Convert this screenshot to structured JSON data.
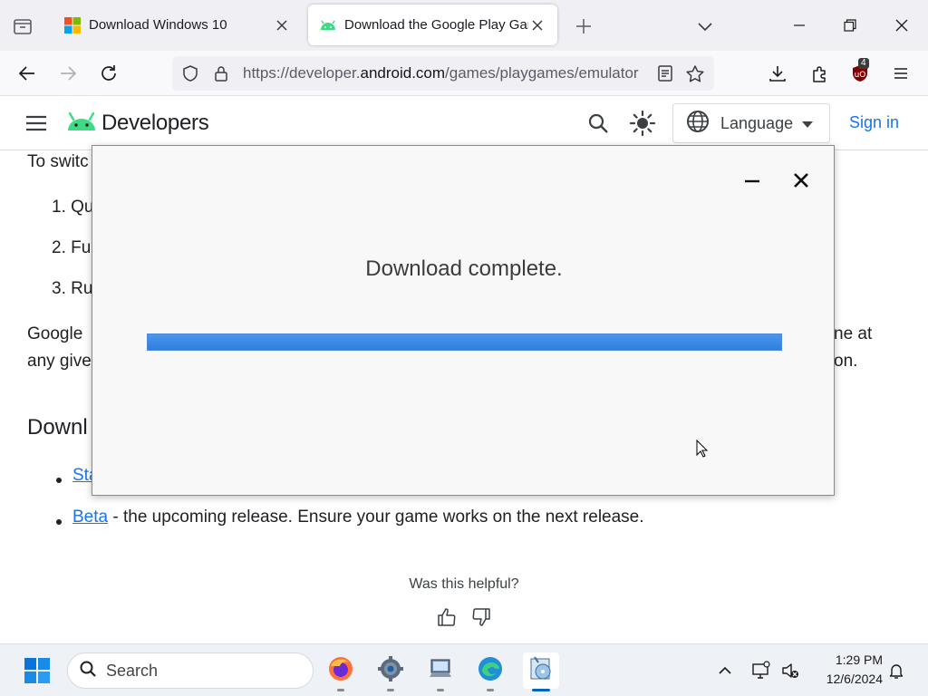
{
  "browser": {
    "tabs": [
      {
        "title": "Download Windows 10",
        "active": false
      },
      {
        "title": "Download the Google Play Games",
        "active": true
      }
    ],
    "url_prefix": "https://developer.",
    "url_domain": "android.com",
    "url_path": "/games/playgames/emulator",
    "extension_badge": "4"
  },
  "site": {
    "brand": "Developers",
    "language_label": "Language",
    "signin_label": "Sign in"
  },
  "content": {
    "intro_fragment": "To switc",
    "steps": [
      "1. Qu",
      "2. Fu",
      "3. Ru"
    ],
    "para_left_1": "Google",
    "para_left_2": "any give",
    "para_right_1": "ne at",
    "para_right_2": "on.",
    "heading_fragment": "Downl",
    "bullet1_link": "Sta",
    "bullet2_link": "Beta",
    "bullet2_text": " - the upcoming release. Ensure your game works on the next release.",
    "helpful_label": "Was this helpful?"
  },
  "dialog": {
    "message": "Download complete.",
    "progress_percent": 100
  },
  "taskbar": {
    "search_placeholder": "Search",
    "time": "1:29 PM",
    "date": "12/6/2024"
  },
  "colors": {
    "link": "#1a73e8",
    "progress": "#2f7fe0",
    "android_green": "#3ddc84"
  }
}
